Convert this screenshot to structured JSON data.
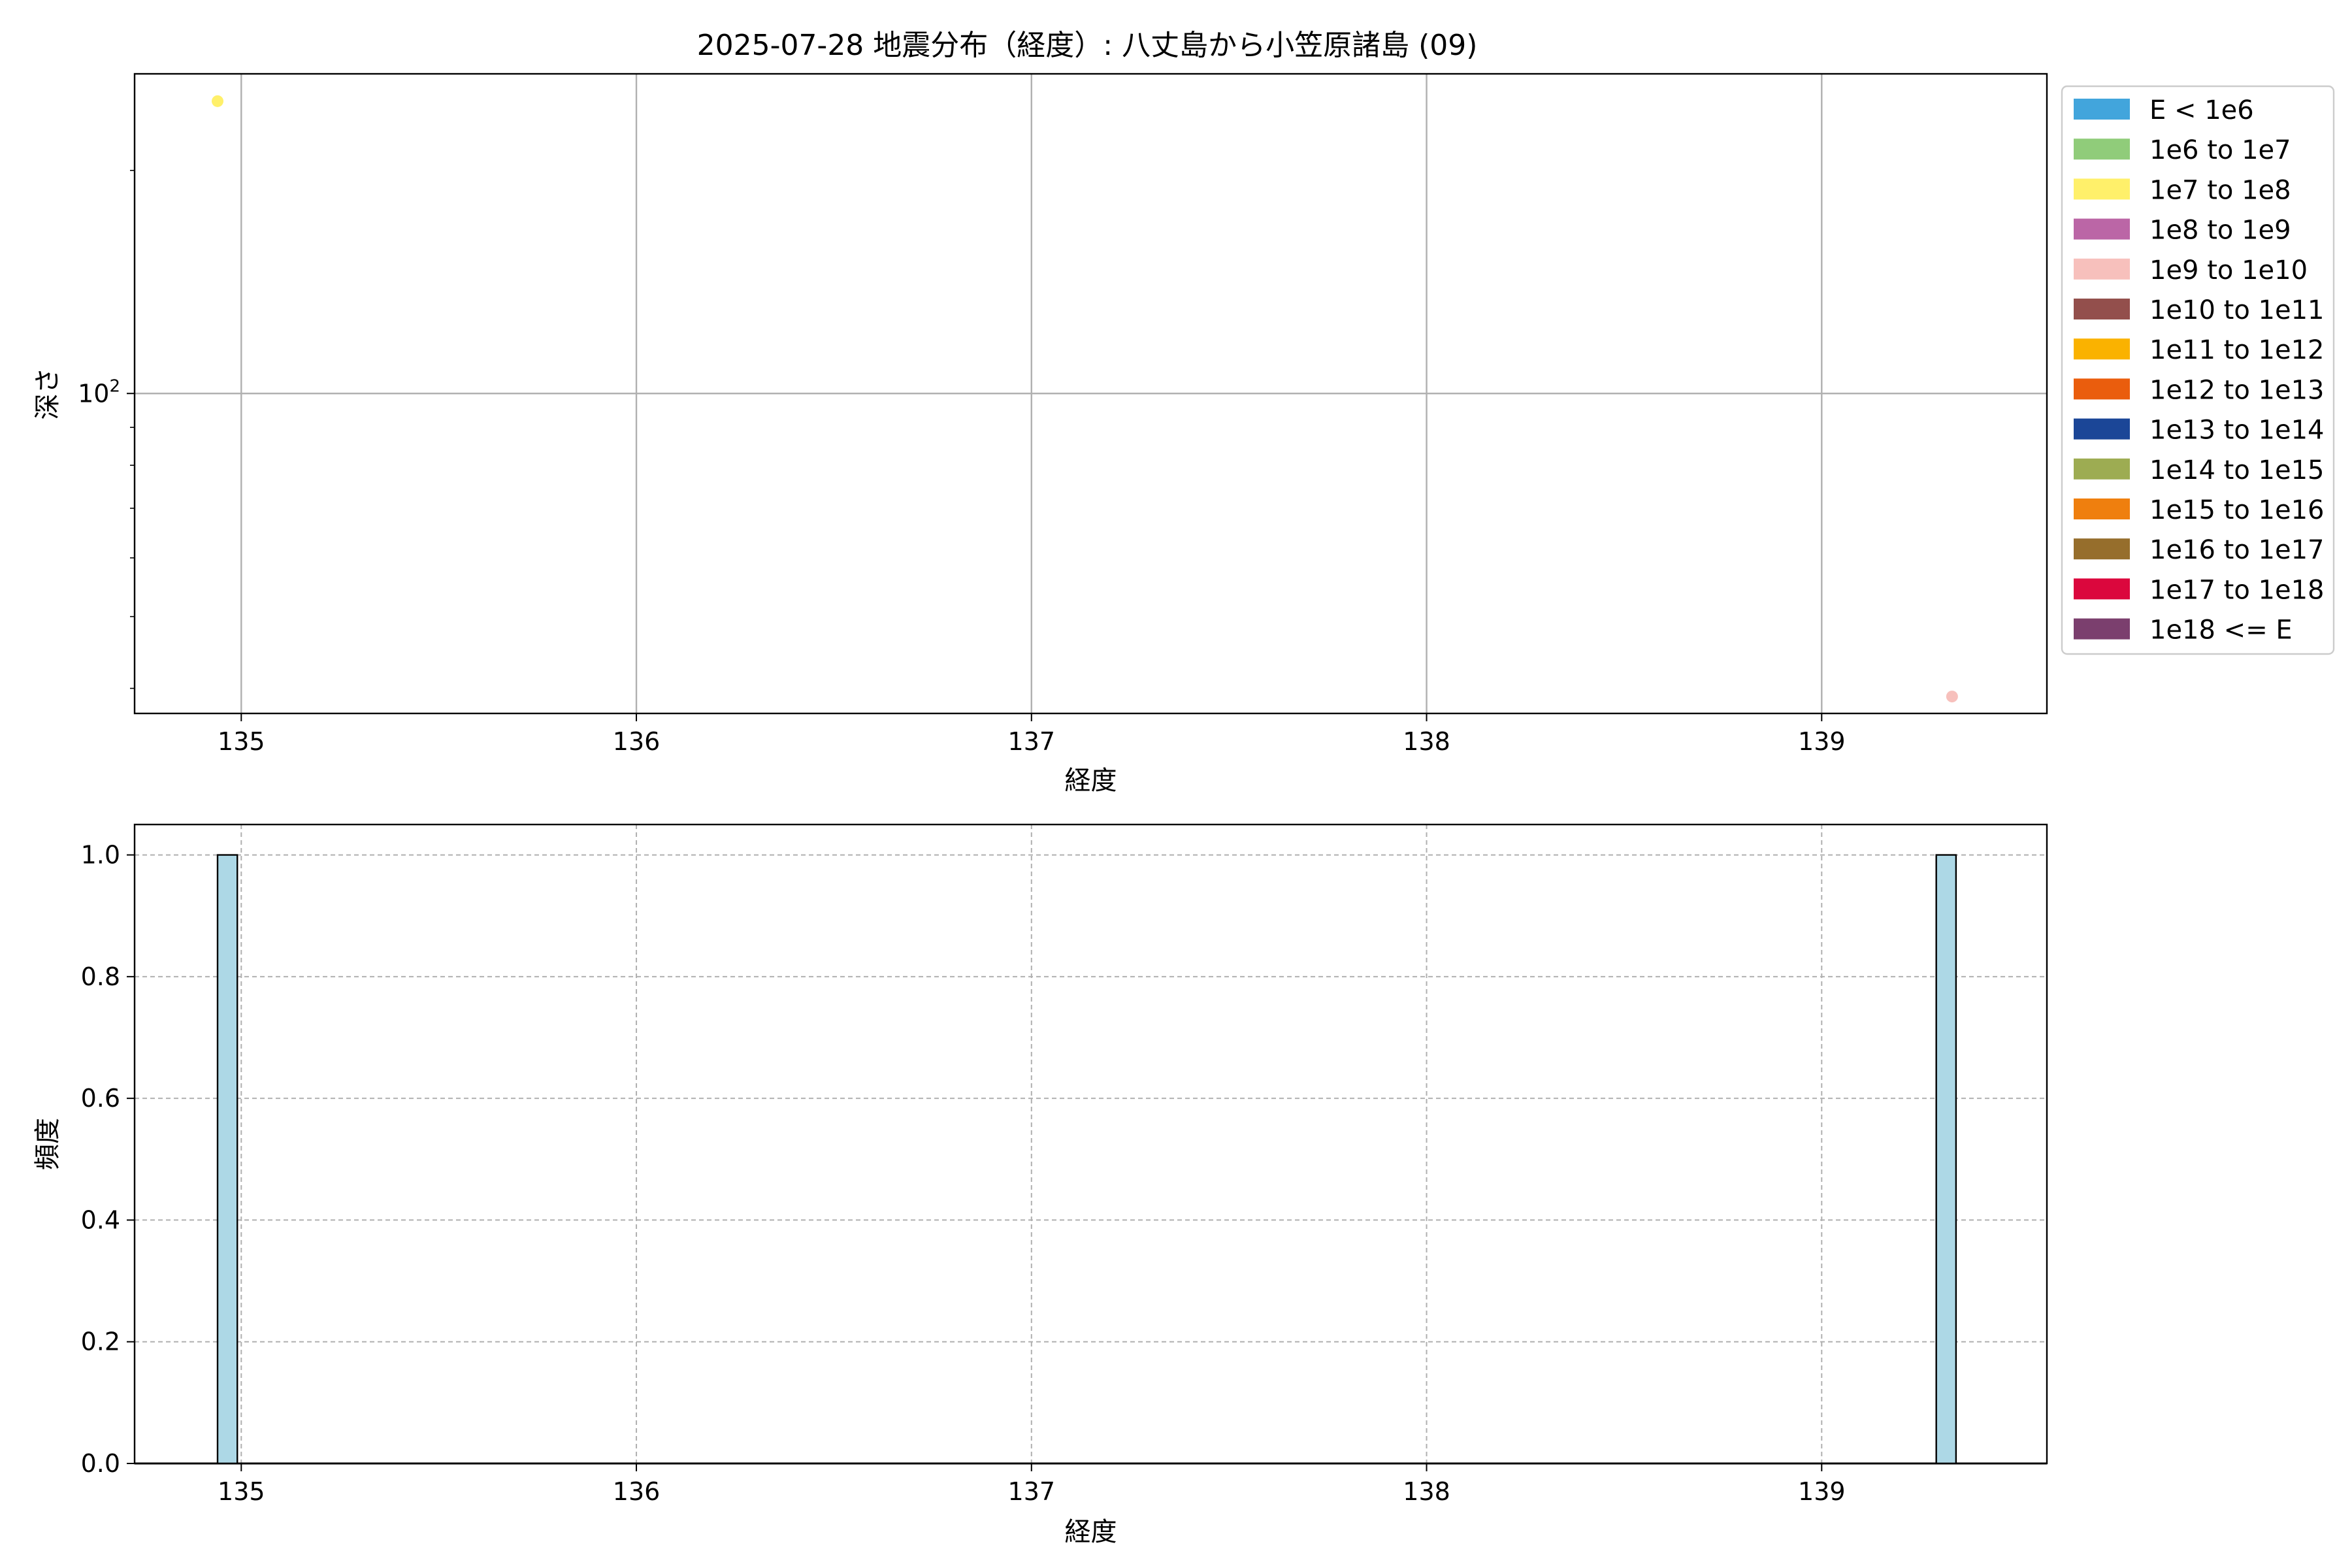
{
  "figure": {
    "title": "2025-07-28 地震分布（経度）: 八丈島から小笠原諸島 (09)"
  },
  "chart_data": [
    {
      "type": "scatter",
      "xlabel": "経度",
      "ylabel": "深さ",
      "xlim": [
        134.73,
        139.57
      ],
      "ylim": [
        37,
        270
      ],
      "yscale": "log",
      "xticks": [
        135,
        136,
        137,
        138,
        139
      ],
      "yticks": [
        {
          "value": 100,
          "base": "10",
          "exp": "2"
        }
      ],
      "grid": true,
      "legend_position": "outside-right",
      "points": [
        {
          "x": 134.94,
          "y": 248,
          "category": "1e7 to 1e8",
          "color": "#fff06a"
        },
        {
          "x": 139.33,
          "y": 39,
          "category": "1e9 to 1e10",
          "color": "#f7c0bc"
        }
      ],
      "legend": [
        {
          "label": "E < 1e6",
          "color": "#42a5dc"
        },
        {
          "label": "1e6 to 1e7",
          "color": "#90cc7a"
        },
        {
          "label": "1e7 to 1e8",
          "color": "#fff06a"
        },
        {
          "label": "1e8 to 1e9",
          "color": "#bb66a6"
        },
        {
          "label": "1e9 to 1e10",
          "color": "#f7c0bc"
        },
        {
          "label": "1e10 to 1e11",
          "color": "#934f4c"
        },
        {
          "label": "1e11 to 1e12",
          "color": "#fab200"
        },
        {
          "label": "1e12 to 1e13",
          "color": "#ea5d0d"
        },
        {
          "label": "1e13 to 1e14",
          "color": "#1b4697"
        },
        {
          "label": "1e14 to 1e15",
          "color": "#9dac52"
        },
        {
          "label": "1e15 to 1e16",
          "color": "#ef7f0e"
        },
        {
          "label": "1e16 to 1e17",
          "color": "#966e2c"
        },
        {
          "label": "1e17 to 1e18",
          "color": "#db073d"
        },
        {
          "label": "1e18 <= E",
          "color": "#7b3f6e"
        }
      ]
    },
    {
      "type": "bar",
      "xlabel": "経度",
      "ylabel": "頻度",
      "xlim": [
        134.73,
        139.57
      ],
      "ylim": [
        0,
        1.05
      ],
      "xticks": [
        135,
        136,
        137,
        138,
        139
      ],
      "yticks": [
        "0.0",
        "0.2",
        "0.4",
        "0.6",
        "0.8",
        "1.0"
      ],
      "grid": true,
      "bar_color": "#add8e6",
      "edge_color": "#000000",
      "bars": [
        {
          "x0": 134.94,
          "x1": 134.99,
          "value": 1.0
        },
        {
          "x0": 139.29,
          "x1": 139.34,
          "value": 1.0
        }
      ]
    }
  ]
}
